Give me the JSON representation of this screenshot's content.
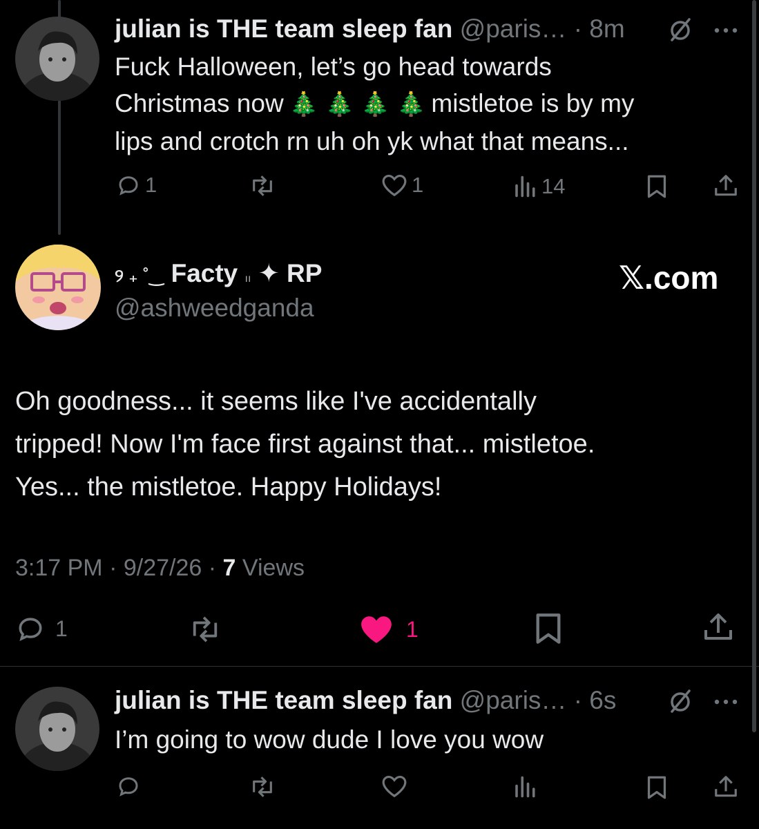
{
  "reply_top": {
    "display_name": "julian is THE team sleep fan",
    "handle": "@paris…",
    "time": "· 8m",
    "text_line1": "Fuck Halloween, let’s go head towards",
    "text_line2_a": "Christmas now",
    "emoji_trees": "🎄 🎄 🎄 🎄",
    "text_line2_b": "mistletoe is by my",
    "text_line3": "lips and crotch rn uh oh yk what that means...",
    "reply_count": "1",
    "like_count": "1",
    "view_count": "14"
  },
  "main_tweet": {
    "name_prefix": "୨ ₊ ˚‿",
    "display_name": "Facty",
    "name_sep": "ıı",
    "name_star": "✦",
    "name_suffix": "RP",
    "handle": "@ashweedganda",
    "site_label": "𝕏.com",
    "text_line1": "Oh goodness... it seems like I've accidentally",
    "text_line2": "tripped! Now I'm face first against that... mistletoe.",
    "text_line3": "Yes... the mistletoe. Happy Holidays!",
    "time": "3:17 PM",
    "date": "9/27/26",
    "views_count": "7",
    "views_label": "Views",
    "reply_count": "1",
    "like_count": "1",
    "like_color": "#f91880"
  },
  "reply_bottom": {
    "display_name": "julian is THE team sleep fan",
    "handle": "@paris…",
    "time": "· 6s",
    "text": "I’m going to wow dude I love you wow"
  },
  "separators": {
    "dot": "·"
  }
}
